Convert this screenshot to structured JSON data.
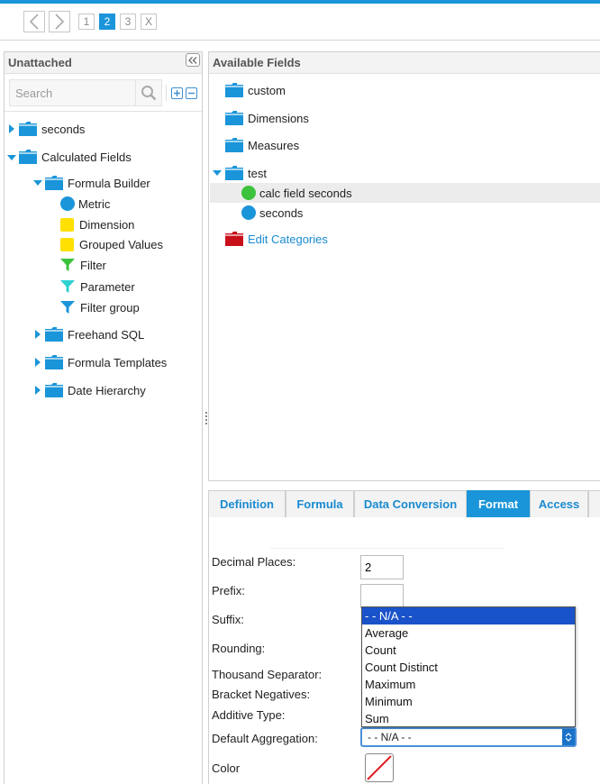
{
  "wizard": {
    "steps": [
      "1",
      "2",
      "3",
      "X"
    ],
    "active_step": "2"
  },
  "left": {
    "title": "Unattached",
    "search_placeholder": "Search",
    "tree": {
      "seconds": "seconds",
      "calculated_fields": "Calculated Fields",
      "formula_builder": "Formula Builder",
      "metric": "Metric",
      "dimension": "Dimension",
      "grouped_values": "Grouped Values",
      "filter": "Filter",
      "parameter": "Parameter",
      "filter_group": "Filter group",
      "freehand_sql": "Freehand SQL",
      "formula_templates": "Formula Templates",
      "date_hierarchy": "Date Hierarchy"
    }
  },
  "available": {
    "title": "Available Fields",
    "items": {
      "custom": "custom",
      "dimensions": "Dimensions",
      "measures": "Measures",
      "test": "test",
      "calc_field_seconds": "calc field seconds",
      "seconds": "seconds",
      "edit_categories": "Edit Categories"
    }
  },
  "tabs": [
    "Definition",
    "Formula",
    "Data Conversion",
    "Format",
    "Access"
  ],
  "active_tab": "Format",
  "format": {
    "decimal_places_label": "Decimal Places:",
    "decimal_places_value": "2",
    "prefix_label": "Prefix:",
    "suffix_label": "Suffix:",
    "rounding_label": "Rounding:",
    "thousand_separator_label": "Thousand Separator:",
    "bracket_negatives_label": "Bracket Negatives:",
    "additive_type_label": "Additive Type:",
    "default_aggregation_label": "Default Aggregation:",
    "default_aggregation_value": "- - N/A - -",
    "color_label": "Color"
  },
  "aggregation_options": [
    "- - N/A - -",
    "Average",
    "Count",
    "Count Distinct",
    "Maximum",
    "Minimum",
    "Sum"
  ],
  "colors": {
    "accent": "#1a95d9",
    "folder": "#1a95d9",
    "metric": "#1a95d9",
    "calc_field": "#3cc23c",
    "dimension": "#ffe000",
    "filter": "#3cc23c",
    "parameter": "#2fd0d0",
    "filter_group": "#1a95d9",
    "edit_categories_folder": "#c8101a",
    "dropdown_selected": "#1a52c9"
  },
  "icons": {
    "back": "chevron-left-icon",
    "forward": "chevron-right-icon",
    "collapse": "double-chevron-left-icon",
    "search": "search-icon",
    "expand_all": "plus-box-icon",
    "collapse_all": "minus-box-icon",
    "folder": "folder-icon",
    "metric": "circle-icon",
    "dimension": "square-icon",
    "filter": "funnel-icon"
  }
}
